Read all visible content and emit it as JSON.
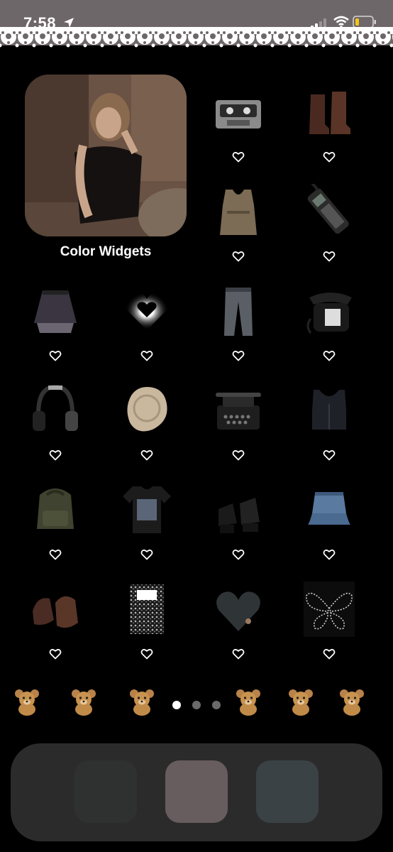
{
  "status_bar": {
    "time": "7:58",
    "icons": [
      "location-arrow-icon",
      "cellular-signal-icon",
      "wifi-icon",
      "battery-low-icon"
    ],
    "background": "#6e6769"
  },
  "widget": {
    "label": "Color Widgets",
    "image": "photo of a woman in a black dress smoking, sepia tone"
  },
  "apps": [
    {
      "name": "cassette-tape",
      "icon": "cassette-icon"
    },
    {
      "name": "boots",
      "icon": "boots-icon"
    },
    {
      "name": "camo-top",
      "icon": "tank-top-icon"
    },
    {
      "name": "brick-phone",
      "icon": "mobile-phone-icon"
    },
    {
      "name": "lace-skirt",
      "icon": "skirt-icon"
    },
    {
      "name": "glow-heart",
      "icon": "heart-glow-icon"
    },
    {
      "name": "jeans",
      "icon": "jeans-icon"
    },
    {
      "name": "rotary-phone",
      "icon": "telephone-icon"
    },
    {
      "name": "headphones",
      "icon": "headphones-icon"
    },
    {
      "name": "wax-seal",
      "icon": "seal-icon"
    },
    {
      "name": "typewriter",
      "icon": "typewriter-icon"
    },
    {
      "name": "corset-top",
      "icon": "top-icon"
    },
    {
      "name": "backpack",
      "icon": "backpack-icon"
    },
    {
      "name": "band-tee",
      "icon": "tshirt-icon"
    },
    {
      "name": "platform-heels",
      "icon": "heels-icon"
    },
    {
      "name": "denim-skirt",
      "icon": "denim-skirt-icon"
    },
    {
      "name": "loafers",
      "icon": "shoes-icon"
    },
    {
      "name": "notebook",
      "icon": "notebook-icon"
    },
    {
      "name": "skate-heart",
      "icon": "heart-board-icon"
    },
    {
      "name": "butterfly",
      "icon": "butterfly-icon"
    }
  ],
  "page_indicator": {
    "pages": 3,
    "current": 1
  },
  "decorations": [
    "teddy-bear-icon",
    "teddy-bear-icon",
    "teddy-bear-icon",
    "teddy-bear-icon",
    "teddy-bear-icon",
    "teddy-bear-icon"
  ],
  "dock": {
    "apps": [
      {
        "icon": "dark-gray-square",
        "color": "#2f3030"
      },
      {
        "icon": "mauve-square",
        "color": "#675d5e"
      },
      {
        "icon": "slate-square",
        "color": "#3b4245"
      }
    ]
  }
}
